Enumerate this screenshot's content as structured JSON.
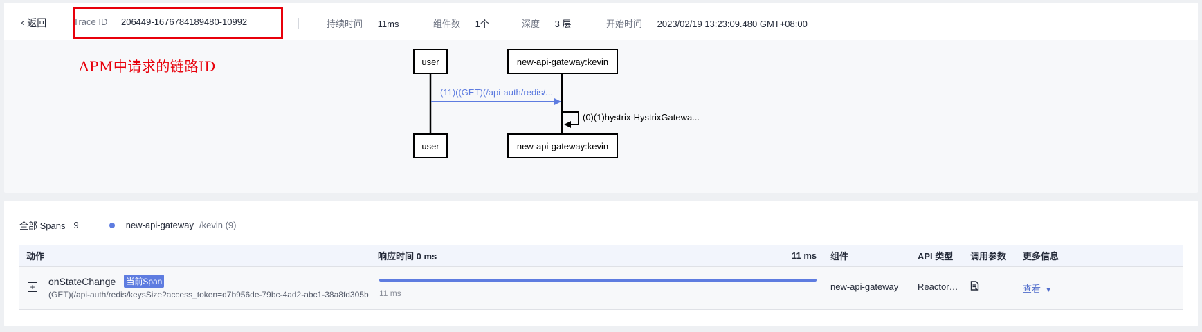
{
  "header": {
    "back_label": "返回",
    "trace_id_label": "Trace ID",
    "trace_id_value": "206449-1676784189480-10992",
    "duration_label": "持续时间",
    "duration_value": "11ms",
    "components_label": "组件数",
    "components_value": "1个",
    "depth_label": "深度",
    "depth_value": "3 层",
    "start_label": "开始时间",
    "start_value": "2023/02/19 13:23:09.480 GMT+08:00"
  },
  "annotation": "APM中请求的链路ID",
  "sequence": {
    "actor_user": "user",
    "actor_gateway": "new-api-gateway:kevin",
    "call_label": "(11)((GET)(/api-auth/redis/...",
    "self_call_label": "(0)(1)hystrix-HystrixGatewa...",
    "call_color": "#5e7ce0"
  },
  "spans": {
    "all_label": "全部 Spans",
    "all_count": "9",
    "legend_service": "new-api-gateway",
    "legend_instance": "/kevin (9)"
  },
  "table": {
    "headers": {
      "action": "动作",
      "response": "响应时间 0 ms",
      "response_max": "11 ms",
      "component": "组件",
      "api_type": "API 类型",
      "params": "调用参数",
      "more": "更多信息"
    },
    "rows": [
      {
        "name": "onStateChange",
        "badge": "当前Span",
        "url": "(GET)(/api-auth/redis/keysSize?access_token=d7b956de-79bc-4ad2-abc1-38a8fd305b",
        "duration": "11 ms",
        "duration_fraction": 1.0,
        "component": "new-api-gateway",
        "api_type": "Reactor…",
        "params_icon": "document-icon",
        "more_label": "查看"
      }
    ]
  },
  "colors": {
    "accent": "#5e7ce0",
    "highlight": "#e8000b"
  }
}
